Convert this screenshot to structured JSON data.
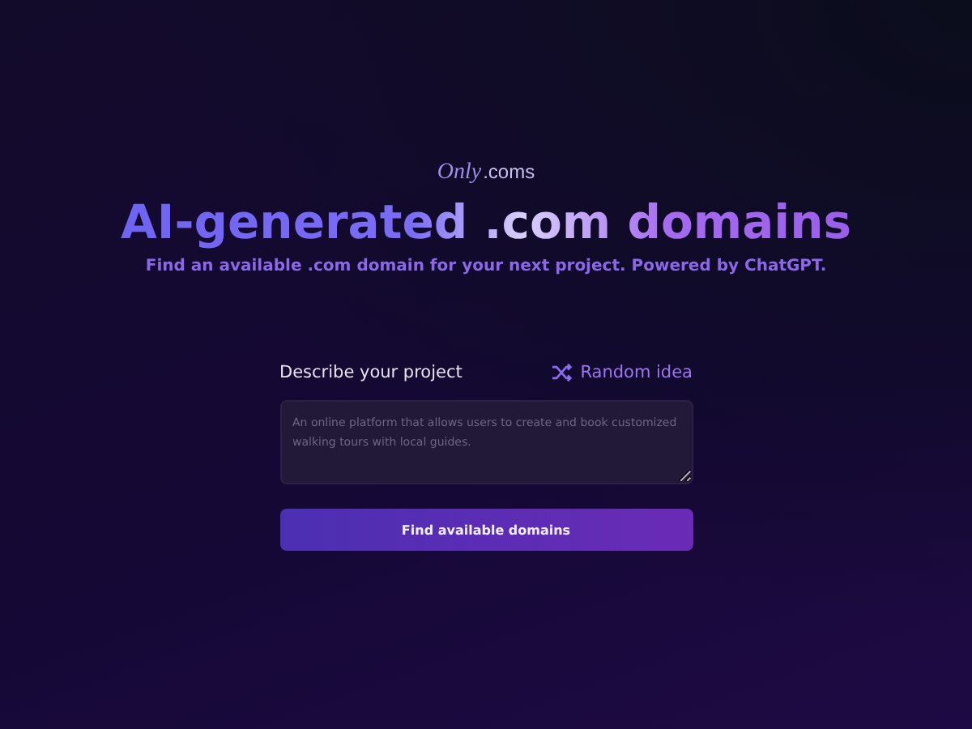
{
  "logo": {
    "script": "Only",
    "suffix": ".coms"
  },
  "headline": "AI-generated .com domains",
  "tagline": "Find an available .com domain for your next project. Powered by ChatGPT.",
  "form": {
    "label": "Describe your project",
    "random_link": "Random idea",
    "placeholder": "An online platform that allows users to create and book customized walking tours with local guides.",
    "submit": "Find available domains"
  }
}
